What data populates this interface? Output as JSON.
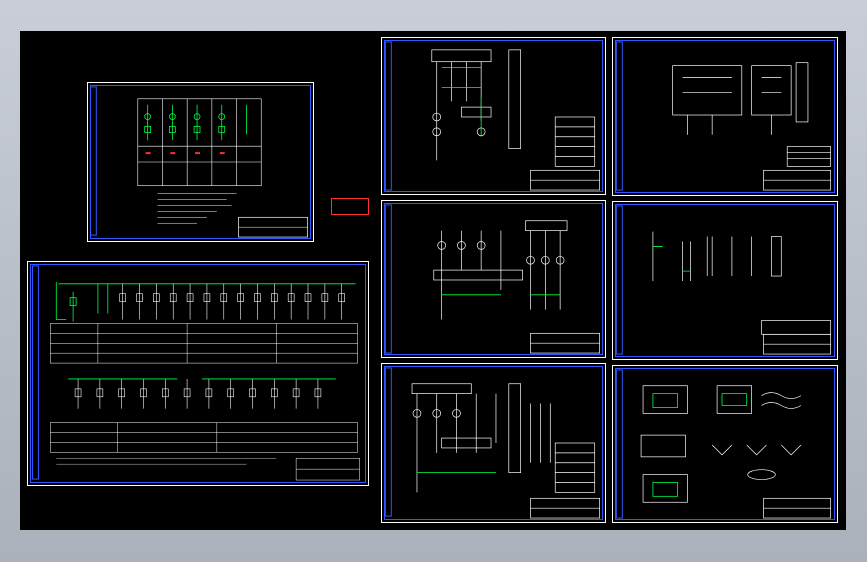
{
  "app": {
    "background": "#000000",
    "frame_color": "#ffffff",
    "border_color": "#3355ff",
    "line_color": "#00ff44",
    "accent": "#ff3030"
  },
  "stamp": {
    "line1": "",
    "line2": ""
  },
  "sheets": [
    {
      "name": "sheet-top-left",
      "kind": "single-line-small",
      "title": ""
    },
    {
      "name": "sheet-bottom-left",
      "kind": "main-single-line",
      "title": ""
    },
    {
      "name": "sheet-middle-1",
      "kind": "control-circuit",
      "title": ""
    },
    {
      "name": "sheet-middle-2",
      "kind": "control-circuit",
      "title": ""
    },
    {
      "name": "sheet-middle-3",
      "kind": "control-circuit",
      "title": ""
    },
    {
      "name": "sheet-right-1",
      "kind": "control-circuit",
      "title": ""
    },
    {
      "name": "sheet-right-2",
      "kind": "wiring",
      "title": ""
    },
    {
      "name": "sheet-right-3",
      "kind": "installation-details",
      "title": ""
    }
  ]
}
